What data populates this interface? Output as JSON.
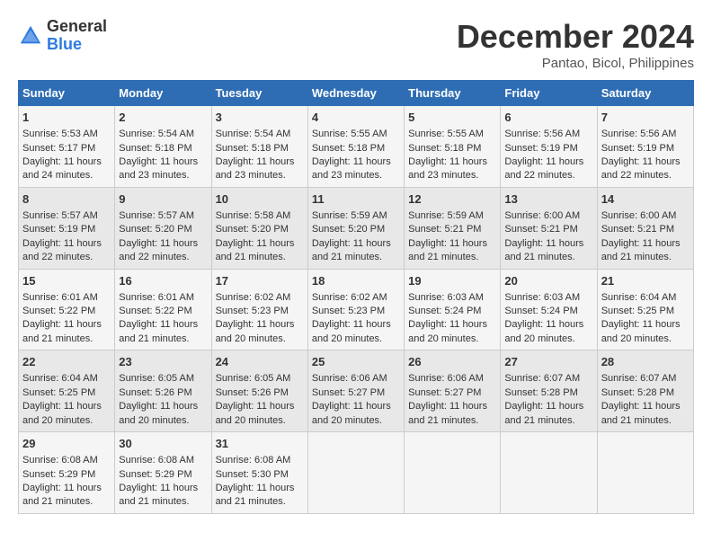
{
  "logo": {
    "general": "General",
    "blue": "Blue"
  },
  "title": "December 2024",
  "subtitle": "Pantao, Bicol, Philippines",
  "days_header": [
    "Sunday",
    "Monday",
    "Tuesday",
    "Wednesday",
    "Thursday",
    "Friday",
    "Saturday"
  ],
  "weeks": [
    [
      {
        "num": "1",
        "info": "Sunrise: 5:53 AM\nSunset: 5:17 PM\nDaylight: 11 hours\nand 24 minutes."
      },
      {
        "num": "2",
        "info": "Sunrise: 5:54 AM\nSunset: 5:18 PM\nDaylight: 11 hours\nand 23 minutes."
      },
      {
        "num": "3",
        "info": "Sunrise: 5:54 AM\nSunset: 5:18 PM\nDaylight: 11 hours\nand 23 minutes."
      },
      {
        "num": "4",
        "info": "Sunrise: 5:55 AM\nSunset: 5:18 PM\nDaylight: 11 hours\nand 23 minutes."
      },
      {
        "num": "5",
        "info": "Sunrise: 5:55 AM\nSunset: 5:18 PM\nDaylight: 11 hours\nand 23 minutes."
      },
      {
        "num": "6",
        "info": "Sunrise: 5:56 AM\nSunset: 5:19 PM\nDaylight: 11 hours\nand 22 minutes."
      },
      {
        "num": "7",
        "info": "Sunrise: 5:56 AM\nSunset: 5:19 PM\nDaylight: 11 hours\nand 22 minutes."
      }
    ],
    [
      {
        "num": "8",
        "info": "Sunrise: 5:57 AM\nSunset: 5:19 PM\nDaylight: 11 hours\nand 22 minutes."
      },
      {
        "num": "9",
        "info": "Sunrise: 5:57 AM\nSunset: 5:20 PM\nDaylight: 11 hours\nand 22 minutes."
      },
      {
        "num": "10",
        "info": "Sunrise: 5:58 AM\nSunset: 5:20 PM\nDaylight: 11 hours\nand 21 minutes."
      },
      {
        "num": "11",
        "info": "Sunrise: 5:59 AM\nSunset: 5:20 PM\nDaylight: 11 hours\nand 21 minutes."
      },
      {
        "num": "12",
        "info": "Sunrise: 5:59 AM\nSunset: 5:21 PM\nDaylight: 11 hours\nand 21 minutes."
      },
      {
        "num": "13",
        "info": "Sunrise: 6:00 AM\nSunset: 5:21 PM\nDaylight: 11 hours\nand 21 minutes."
      },
      {
        "num": "14",
        "info": "Sunrise: 6:00 AM\nSunset: 5:21 PM\nDaylight: 11 hours\nand 21 minutes."
      }
    ],
    [
      {
        "num": "15",
        "info": "Sunrise: 6:01 AM\nSunset: 5:22 PM\nDaylight: 11 hours\nand 21 minutes."
      },
      {
        "num": "16",
        "info": "Sunrise: 6:01 AM\nSunset: 5:22 PM\nDaylight: 11 hours\nand 21 minutes."
      },
      {
        "num": "17",
        "info": "Sunrise: 6:02 AM\nSunset: 5:23 PM\nDaylight: 11 hours\nand 20 minutes."
      },
      {
        "num": "18",
        "info": "Sunrise: 6:02 AM\nSunset: 5:23 PM\nDaylight: 11 hours\nand 20 minutes."
      },
      {
        "num": "19",
        "info": "Sunrise: 6:03 AM\nSunset: 5:24 PM\nDaylight: 11 hours\nand 20 minutes."
      },
      {
        "num": "20",
        "info": "Sunrise: 6:03 AM\nSunset: 5:24 PM\nDaylight: 11 hours\nand 20 minutes."
      },
      {
        "num": "21",
        "info": "Sunrise: 6:04 AM\nSunset: 5:25 PM\nDaylight: 11 hours\nand 20 minutes."
      }
    ],
    [
      {
        "num": "22",
        "info": "Sunrise: 6:04 AM\nSunset: 5:25 PM\nDaylight: 11 hours\nand 20 minutes."
      },
      {
        "num": "23",
        "info": "Sunrise: 6:05 AM\nSunset: 5:26 PM\nDaylight: 11 hours\nand 20 minutes."
      },
      {
        "num": "24",
        "info": "Sunrise: 6:05 AM\nSunset: 5:26 PM\nDaylight: 11 hours\nand 20 minutes."
      },
      {
        "num": "25",
        "info": "Sunrise: 6:06 AM\nSunset: 5:27 PM\nDaylight: 11 hours\nand 20 minutes."
      },
      {
        "num": "26",
        "info": "Sunrise: 6:06 AM\nSunset: 5:27 PM\nDaylight: 11 hours\nand 21 minutes."
      },
      {
        "num": "27",
        "info": "Sunrise: 6:07 AM\nSunset: 5:28 PM\nDaylight: 11 hours\nand 21 minutes."
      },
      {
        "num": "28",
        "info": "Sunrise: 6:07 AM\nSunset: 5:28 PM\nDaylight: 11 hours\nand 21 minutes."
      }
    ],
    [
      {
        "num": "29",
        "info": "Sunrise: 6:08 AM\nSunset: 5:29 PM\nDaylight: 11 hours\nand 21 minutes."
      },
      {
        "num": "30",
        "info": "Sunrise: 6:08 AM\nSunset: 5:29 PM\nDaylight: 11 hours\nand 21 minutes."
      },
      {
        "num": "31",
        "info": "Sunrise: 6:08 AM\nSunset: 5:30 PM\nDaylight: 11 hours\nand 21 minutes."
      },
      {
        "num": "",
        "info": ""
      },
      {
        "num": "",
        "info": ""
      },
      {
        "num": "",
        "info": ""
      },
      {
        "num": "",
        "info": ""
      }
    ]
  ]
}
